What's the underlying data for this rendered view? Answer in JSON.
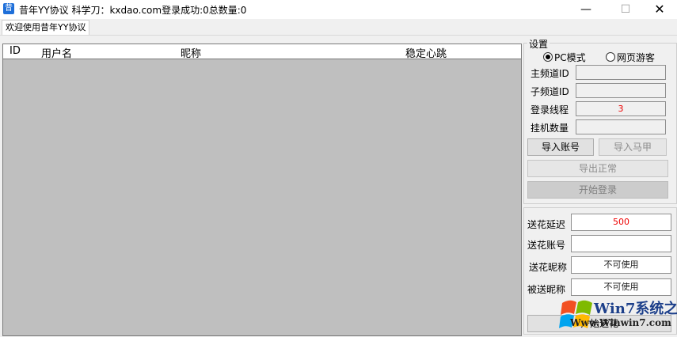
{
  "window": {
    "title": "昔年YY协议  科学刀：kxdao.com登录成功:0总数量:0",
    "icon_glyph": "昔",
    "minimize_glyph": "—",
    "maximize_glyph": "☐",
    "close_glyph": "✕"
  },
  "tab": {
    "label": "欢迎使用昔年YY协议"
  },
  "listview": {
    "columns": [
      "ID",
      "用户名",
      "昵称",
      "稳定心跳"
    ]
  },
  "settings": {
    "legend": "设置",
    "mode_pc": "PC模式",
    "mode_web": "网页游客",
    "main_channel_label": "主频道ID",
    "main_channel_value": "",
    "sub_channel_label": "子频道ID",
    "sub_channel_value": "",
    "login_threads_label": "登录线程",
    "login_threads_value": "3",
    "idle_count_label": "挂机数量",
    "idle_count_value": "",
    "import_account_btn": "导入账号",
    "import_vest_btn": "导入马甲",
    "export_normal_btn": "导出正常",
    "start_login_btn": "开始登录"
  },
  "flowers": {
    "delay_label": "送花延迟",
    "delay_value": "500",
    "account_label": "送花账号",
    "account_value": "",
    "nickname_label": "送花昵称",
    "nickname_value": "不可使用",
    "target_label": "被送昵称",
    "target_value": "不可使用",
    "start_btn": "开始送花"
  },
  "watermark": {
    "brand": "Win7系统之家",
    "url": "Www.Winwin7.com"
  },
  "colors": {
    "accent_red": "#e00000",
    "list_bg": "#bfbfbf"
  }
}
